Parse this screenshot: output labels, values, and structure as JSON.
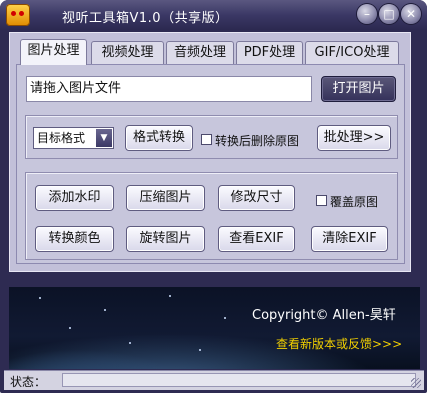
{
  "window": {
    "title": "视听工具箱V1.0（共享版）"
  },
  "titlebar_buttons": [
    {
      "icon": "minimize-icon",
      "glyph": "–"
    },
    {
      "icon": "maximize-icon",
      "glyph": "□"
    },
    {
      "icon": "close-icon",
      "glyph": "✕"
    }
  ],
  "tabs": [
    "图片处理",
    "视频处理",
    "音频处理",
    "PDF处理",
    "GIF/ICO处理"
  ],
  "active_tab": "图片处理",
  "file_input": {
    "value": "请拖入图片文件"
  },
  "open_button": "打开图片",
  "format": {
    "select_value": "目标格式",
    "convert_button": "格式转换",
    "delete_after_convert_label": "转换后删除原图",
    "delete_after_convert_checked": false,
    "batch_button": "批处理>>"
  },
  "actions": {
    "row1": [
      "添加水印",
      "压缩图片",
      "修改尺寸"
    ],
    "overwrite_label": "覆盖原图",
    "overwrite_checked": false,
    "row2": [
      "转换颜色",
      "旋转图片",
      "查看EXIF",
      "清除EXIF"
    ]
  },
  "banner": {
    "copyright": "Copyright© Allen-昊轩",
    "feedback_link": "查看新版本或反馈>>>"
  },
  "status": {
    "label": "状态：",
    "value": ""
  },
  "colors": {
    "window_frame": "#2e2b52",
    "client": "#c2c0d9",
    "feedback_link": "#f2d000"
  }
}
